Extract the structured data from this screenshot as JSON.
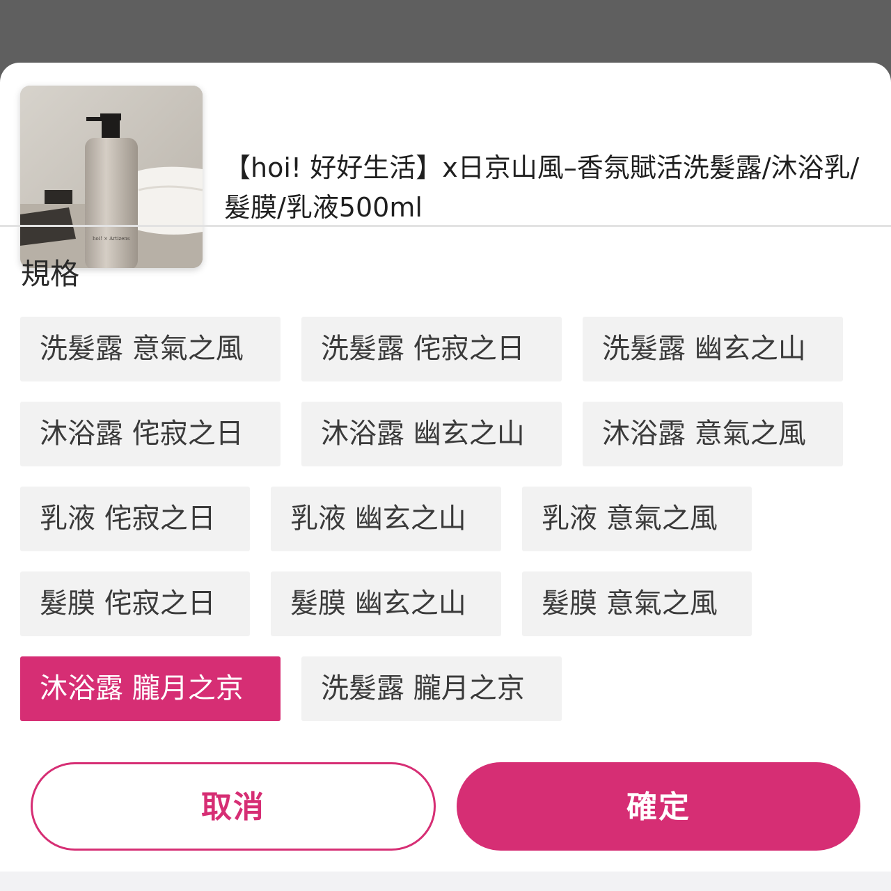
{
  "product": {
    "title": "【hoi! 好好生活】x日京山風–香氛賦活洗髮露/沐浴乳/髮膜/乳液500ml",
    "image_icon": "product-bottle-photo",
    "image_bottle_text": "hoi! × Artizens"
  },
  "spec": {
    "label": "規格",
    "options": [
      "洗髮露 意氣之風",
      "洗髮露 侘寂之日",
      "洗髮露 幽玄之山",
      "沐浴露 侘寂之日",
      "沐浴露 幽玄之山",
      "沐浴露 意氣之風",
      "乳液 侘寂之日",
      "乳液 幽玄之山",
      "乳液 意氣之風",
      "髮膜 侘寂之日",
      "髮膜 幽玄之山",
      "髮膜 意氣之風",
      "沐浴露 朧月之京",
      "洗髮露 朧月之京"
    ],
    "selected": "沐浴露 朧月之京"
  },
  "actions": {
    "cancel_label": "取消",
    "confirm_label": "確定"
  },
  "colors": {
    "accent": "#d62e74",
    "option_bg": "#f2f2f2",
    "overlay": "#5f5f5f"
  }
}
